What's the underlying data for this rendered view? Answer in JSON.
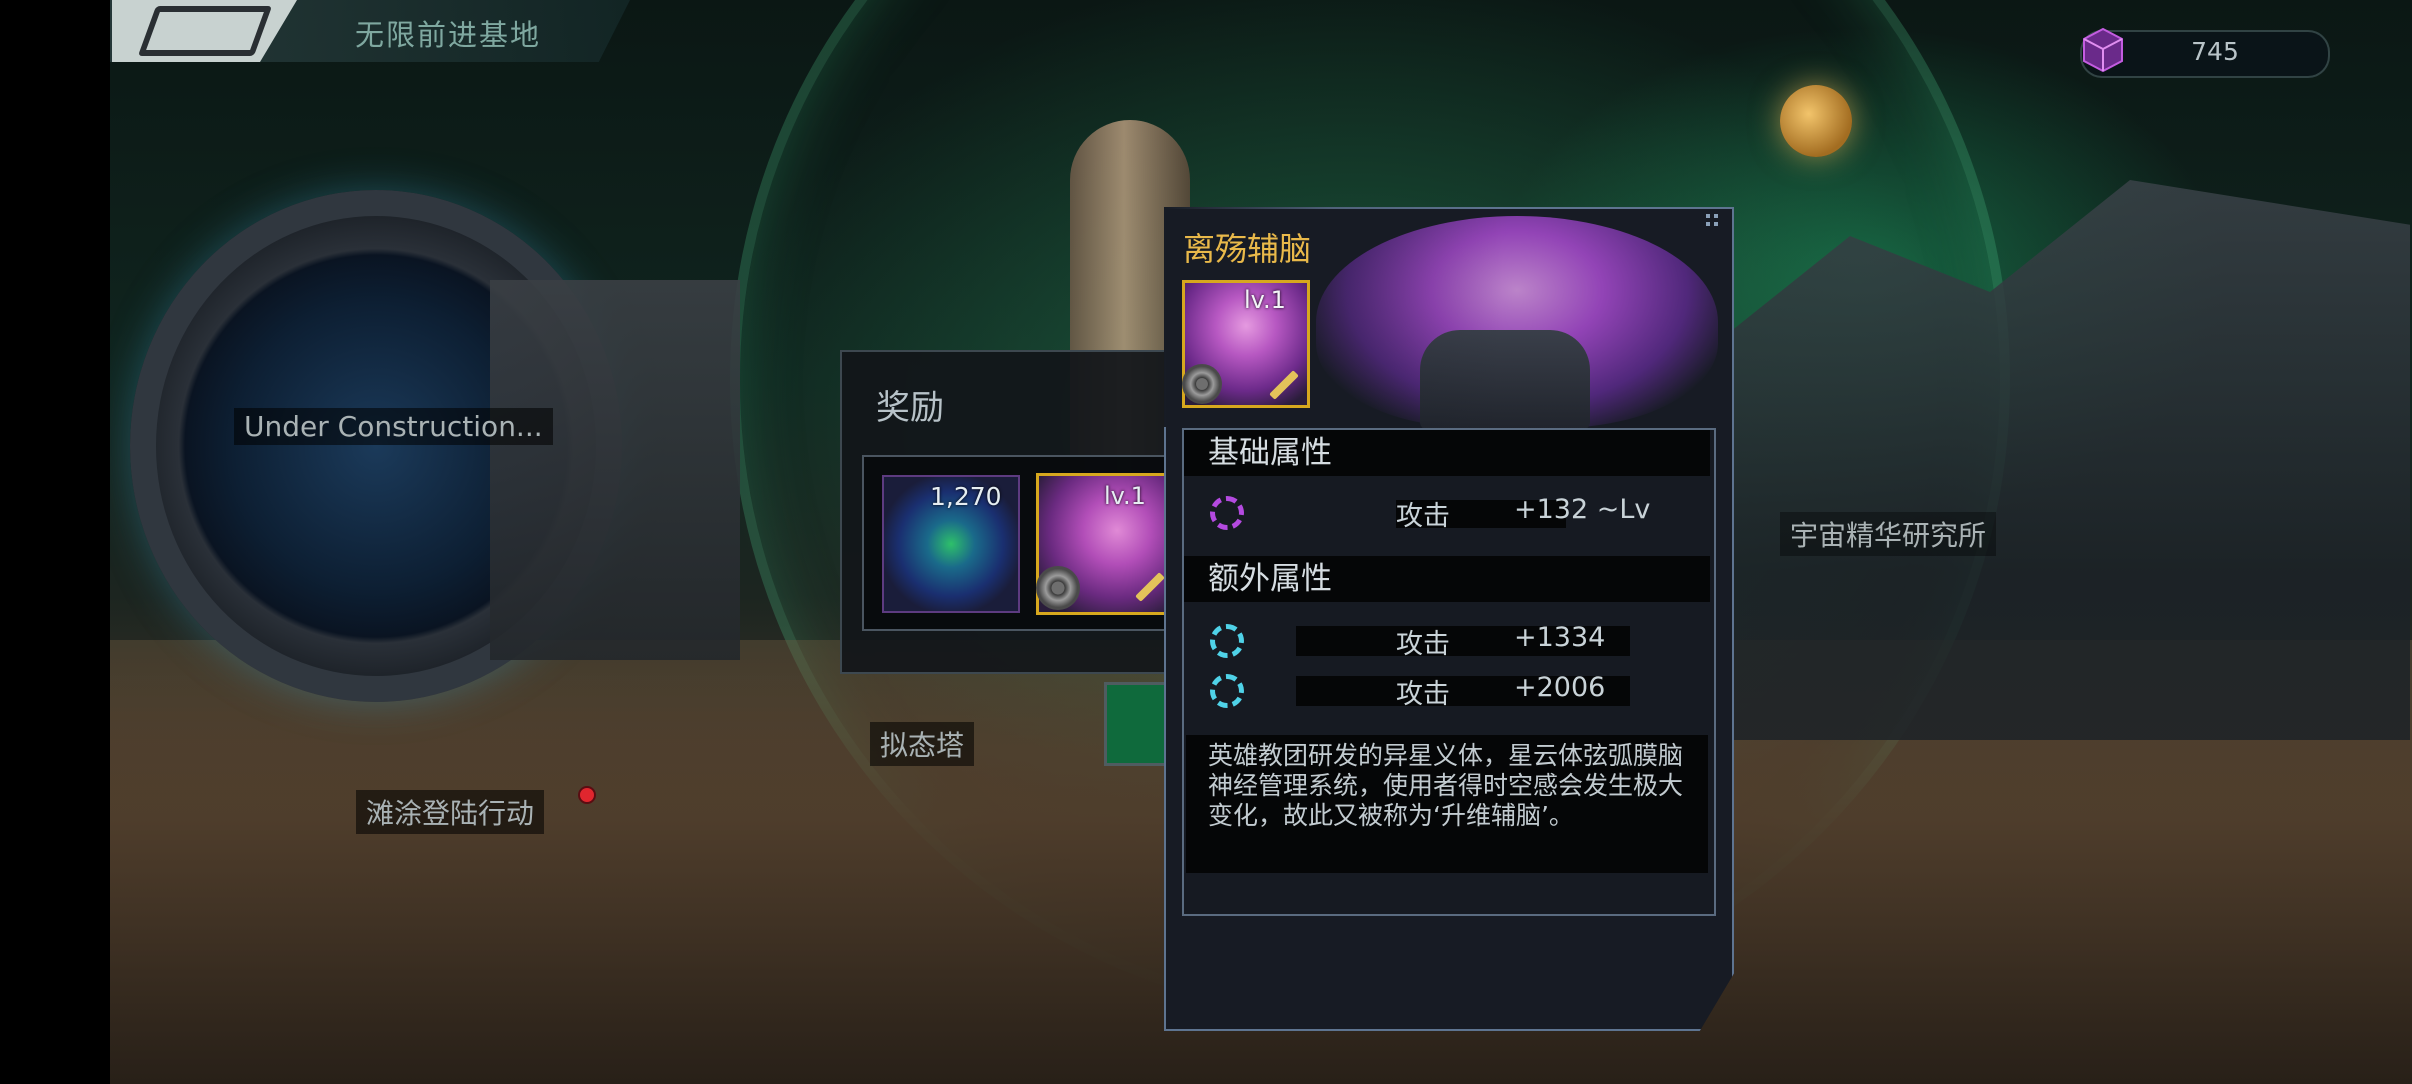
{
  "hud": {
    "location_title": "无限前进基地",
    "currency": {
      "icon": "cube-icon",
      "value": "745",
      "color": "#b44ae0"
    }
  },
  "map_labels": {
    "construction": "Under Construction...",
    "research": "宇宙精华研究所",
    "tower": "拟态塔",
    "beach": "滩涂登陆行动"
  },
  "reward": {
    "title": "奖励",
    "items": [
      {
        "icon": "nebula-orb-icon",
        "count": "1,270"
      },
      {
        "icon": "brain-icon",
        "level": "lv.1"
      }
    ]
  },
  "detail": {
    "name": "离殇辅脑",
    "level": "lv.1",
    "colors": {
      "title": "#e9b94a",
      "frame": "#5e7490",
      "rarity": "#d7a81e"
    },
    "base_section": {
      "title": "基础属性",
      "stats": [
        {
          "name": "攻击",
          "value": "+132 ~Lv",
          "icon": "purple-gear-icon"
        }
      ]
    },
    "extra_section": {
      "title": "额外属性",
      "stats": [
        {
          "name": "攻击",
          "value": "+1334",
          "icon": "cyan-gear-icon"
        },
        {
          "name": "攻击",
          "value": "+2006",
          "icon": "cyan-gear-icon"
        }
      ]
    },
    "description": "英雄教团研发的异星义体，星云体弦弧膜脑神经管理系统，使用者得时空感会发生极大变化，故此又被称为‘升维辅脑’。"
  }
}
